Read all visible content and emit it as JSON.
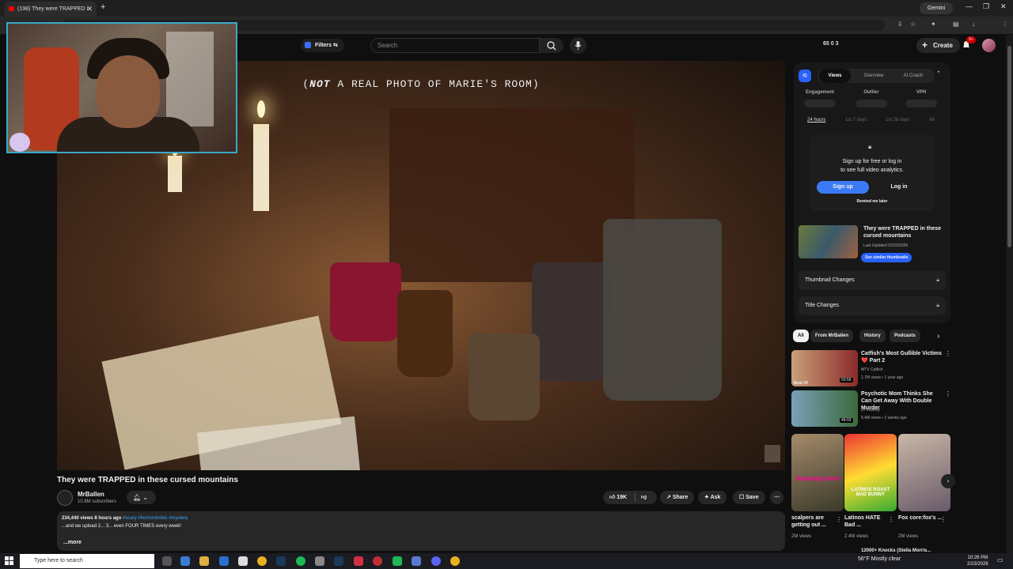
{
  "browser": {
    "tab_title": "(198) They were TRAPPED i",
    "new_tab": "+",
    "gemini": "Gemini",
    "address_hint": "youtube.com/watch?v=..."
  },
  "youtube_header": {
    "filters_label": "Filters",
    "search_placeholder": "Search",
    "stats": "65   0   3",
    "create_label": "Create",
    "notif_badge": "9+"
  },
  "video": {
    "overlay_caption_a": "NOT",
    "overlay_caption_b": " A REAL PHOTO OF MARIE'S ROOM)",
    "overlay_caption_paren": "(",
    "title": "They were TRAPPED in these cursed mountains",
    "channel": "MrBallen",
    "subscribers": "10.8M subscribers",
    "likes": "19K",
    "share_label": "Share",
    "ask_label": "Ask",
    "save_label": "Save",
    "views_time": "234,440 views  8 hours ago",
    "hashtags": "#scary #horrorstories #mystery",
    "desc_line": "...and we upload 2... 3... even FOUR TIMES every week!",
    "more_label": "...more"
  },
  "analytics": {
    "iq": "IQ",
    "tabs": [
      "Views",
      "Overview",
      "AI Coach"
    ],
    "metrics": [
      "Engagement",
      "Outlier",
      "VPH"
    ],
    "ranges": [
      "24 hours",
      "1st 7 days",
      "1st 28 days",
      "All"
    ],
    "lock_line1": "Sign up for free or log in",
    "lock_line2": "to see full video analytics.",
    "signup": "Sign up",
    "login": "Log in",
    "remind": "Remind me later",
    "card_title": "They were TRAPPED in these cursed mountains",
    "card_updated": "Last Updated 02/23/2026",
    "similar_btn": "See similar thumbnails",
    "thumb_changes": "Thumbnail Changes",
    "title_changes": "Title Changes"
  },
  "chips": [
    "All",
    "From MrBallen",
    "History",
    "Podcasts"
  ],
  "recommendations": [
    {
      "title": "Catfish's Most Gullible Victims ❤️ Part 2",
      "channel": "MTV Catfish",
      "meta": "1.7M views • 1 year ago",
      "duration": "50:56",
      "label": "Best Of"
    },
    {
      "title": "Psychotic Mom Thinks She Can Get Away With Double Murder",
      "channel": "Dr Insanity",
      "meta": "5.4M views • 2 weeks ago",
      "duration": "49:03"
    }
  ],
  "shorts": [
    {
      "title": "scalpers are getting out ...",
      "views": "2M views",
      "overlay": "dumping them"
    },
    {
      "title": "Latinos HATE Bad ...",
      "views": "2.4M views",
      "overlay": "LATINOS ROAST BAD BUNNY"
    },
    {
      "title": "Fox core:fox's ...",
      "views": "2M views",
      "overlay": ""
    }
  ],
  "next_peek": "12000+ Knocks (Stella Morris...",
  "taskbar": {
    "search": "Type here to search",
    "weather": "56°F  Mostly clear",
    "time": "10:26 PM",
    "date": "2/23/2026"
  }
}
